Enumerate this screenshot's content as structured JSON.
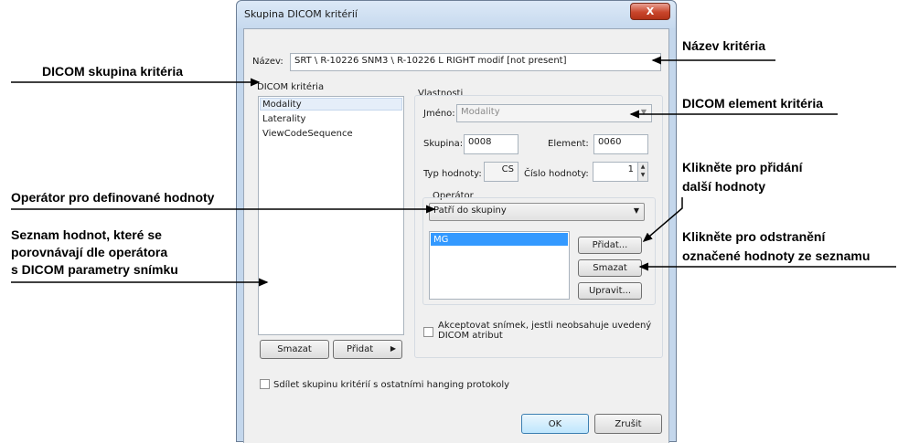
{
  "window": {
    "title": "Skupina DICOM kritérií",
    "close_label": "X"
  },
  "name_field": {
    "label": "Název:",
    "value": "SRT \\ R-10226 SNM3 \\ R-10226  L RIGHT modif [not present]"
  },
  "criteria": {
    "label": "DICOM kritéria",
    "items": [
      "Modality",
      "Laterality",
      "ViewCodeSequence"
    ],
    "delete_label": "Smazat",
    "add_label": "Přidat"
  },
  "properties": {
    "label": "Vlastnosti",
    "name_label": "Jméno:",
    "name_value": "Modality",
    "group_label": "Skupina:",
    "group_value": "0008",
    "element_label": "Element:",
    "element_value": "0060",
    "type_label": "Typ hodnoty:",
    "type_value": "CS",
    "count_label": "Číslo hodnoty:",
    "count_value": "1",
    "operator": {
      "label": "Operátor",
      "selected": "Patří do skupiny",
      "values": [
        "MG"
      ],
      "add_label": "Přidat...",
      "delete_label": "Smazat",
      "edit_label": "Upravit..."
    },
    "accept_label_1": "Akceptovat snímek, jestli neobsahuje uvedený",
    "accept_label_2": "DICOM atribut"
  },
  "share_label": "Sdílet skupinu kritérií s ostatními hanging protokoly",
  "ok_label": "OK",
  "cancel_label": "Zrušit",
  "callouts": {
    "criteria_name": "Název kritéria",
    "dicom_group": "DICOM skupina kritéria",
    "dicom_element": "DICOM element kritéria",
    "add_value_1": "Klikněte pro přidání",
    "add_value_2": "další hodnoty",
    "operator": "Operátor pro definované hodnoty",
    "remove_value_1": "Klikněte pro odstranění",
    "remove_value_2": "označené hodnoty ze seznamu",
    "value_list_1": "Seznam hodnot, které se",
    "value_list_2": "porovnávají dle operátora",
    "value_list_3": "s DICOM parametry snímku"
  }
}
